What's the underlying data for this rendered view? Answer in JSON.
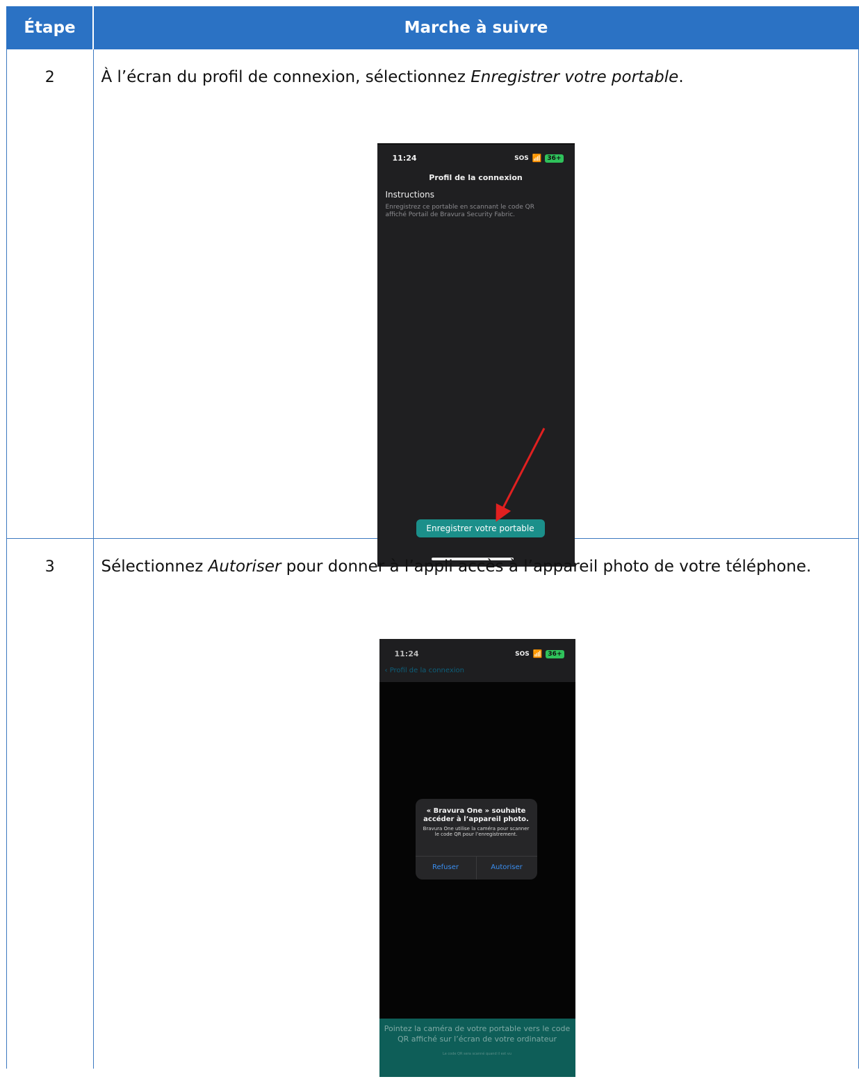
{
  "table": {
    "header_step": "Étape",
    "header_instructions": "Marche à suivre"
  },
  "rows": [
    {
      "step": "2",
      "text_before": "À l’écran du profil de connexion, sélectionnez ",
      "text_em": "Enregistrer votre portable",
      "text_after": ".",
      "screenshot": {
        "time": "11:24",
        "status_sos": "SOS",
        "battery": "36+",
        "title": "Profil de la connexion",
        "instructions_heading": "Instructions",
        "instructions_text": "Enregistrez ce portable en scannant le code QR affiché Portail de Bravura Security Fabric.",
        "button_label": "Enregistrer votre portable",
        "button_color": "#1b8f8a",
        "arrow_color": "#e02020"
      }
    },
    {
      "step": "3",
      "text_before": "Sélectionnez ",
      "text_em": "Autoriser",
      "text_after": " pour donner à l’appli accès à l’appareil photo de votre téléphone.",
      "screenshot": {
        "time": "11:24",
        "status_sos": "SOS",
        "battery": "36+",
        "back_label": "Profil de la connexion",
        "dialog_title": "« Bravura One » souhaite accéder à l’appareil photo.",
        "dialog_text": "Bravura One utilise la caméra pour scanner le code QR pour l’enregistrement.",
        "refuse_label": "Refuser",
        "allow_label": "Autoriser",
        "banner_text": "Pointez la caméra de votre portable vers le code QR affiché sur l’écran de votre ordinateur",
        "banner_subtext": "Le code QR sera scanné quand il est vu",
        "banner_color": "#0e5e58"
      }
    }
  ],
  "colors": {
    "header_bg": "#2b72c4",
    "border": "#3b78c0"
  }
}
